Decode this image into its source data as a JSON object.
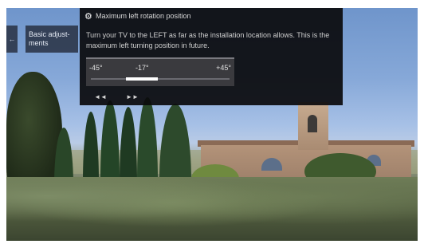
{
  "side_menu": {
    "back_glyph": "←",
    "item_label": "Basic adjust-\nments"
  },
  "dialog": {
    "title": "Maximum left rotation position",
    "icon": "gear-icon",
    "body": "Turn your TV to the LEFT as far as the installation location allows. This is the maximum left turning position in future.",
    "slider": {
      "min_label": "-45°",
      "current_label": "-17°",
      "max_label": "+45°",
      "min_value": -45,
      "max_value": 45,
      "current_value": -17
    },
    "nav": {
      "left_label": "◄◄",
      "right_label": "►►"
    }
  }
}
